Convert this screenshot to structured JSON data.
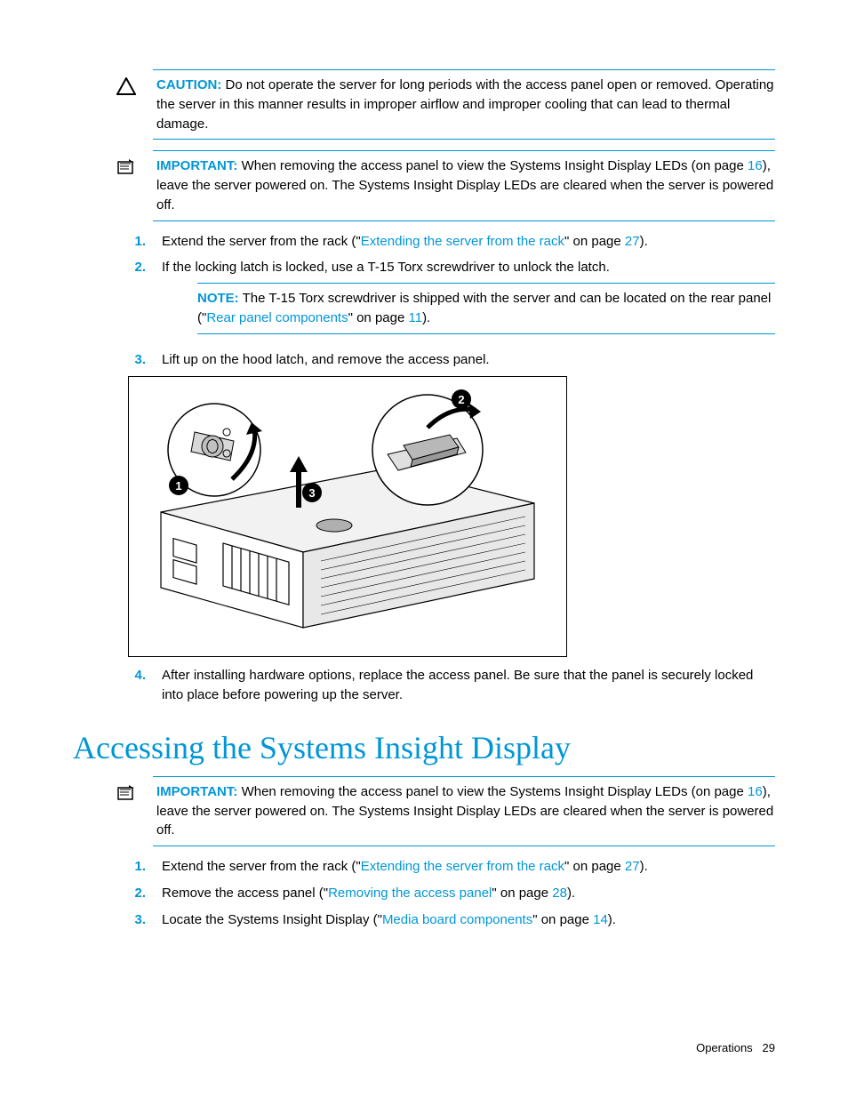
{
  "admonitions": {
    "caution": {
      "label": "CAUTION:",
      "text": "Do not operate the server for long periods with the access panel open or removed. Operating the server in this manner results in improper airflow and improper cooling that can lead to thermal damage."
    },
    "important1": {
      "label": "IMPORTANT:",
      "pre": "When removing the access panel to view the Systems Insight Display LEDs (on page ",
      "link_page": "16",
      "post": "), leave the server powered on. The Systems Insight Display LEDs are cleared when the server is powered off."
    },
    "note": {
      "label": "NOTE:",
      "pre": "The T-15 Torx screwdriver is shipped with the server and can be located on the rear panel (\"",
      "link_text": "Rear panel components",
      "mid": "\" on page ",
      "link_page": "11",
      "post": ")."
    },
    "important2": {
      "label": "IMPORTANT:",
      "pre": "When removing the access panel to view the Systems Insight Display LEDs (on page ",
      "link_page": "16",
      "post": "), leave the server powered on. The Systems Insight Display LEDs are cleared when the server is powered off."
    }
  },
  "steps1": {
    "s1": {
      "num": "1.",
      "pre": "Extend the server from the rack (\"",
      "link": "Extending the server from the rack",
      "mid": "\" on page ",
      "page": "27",
      "post": ")."
    },
    "s2": {
      "num": "2.",
      "text": "If the locking latch is locked, use a T-15 Torx screwdriver to unlock the latch."
    },
    "s3": {
      "num": "3.",
      "text": "Lift up on the hood latch, and remove the access panel."
    },
    "s4": {
      "num": "4.",
      "text": "After installing hardware options, replace the access panel. Be sure that the panel is securely locked into place before powering up the server."
    }
  },
  "section_heading": "Accessing the Systems Insight Display",
  "steps2": {
    "s1": {
      "num": "1.",
      "pre": "Extend the server from the rack (\"",
      "link": "Extending the server from the rack",
      "mid": "\" on page ",
      "page": "27",
      "post": ")."
    },
    "s2": {
      "num": "2.",
      "pre": "Remove the access panel (\"",
      "link": "Removing the access panel",
      "mid": "\" on page ",
      "page": "28",
      "post": ")."
    },
    "s3": {
      "num": "3.",
      "pre": "Locate the Systems Insight Display (\"",
      "link": "Media board components",
      "mid": "\" on page ",
      "page": "14",
      "post": ")."
    }
  },
  "footer": {
    "section": "Operations",
    "page": "29"
  }
}
